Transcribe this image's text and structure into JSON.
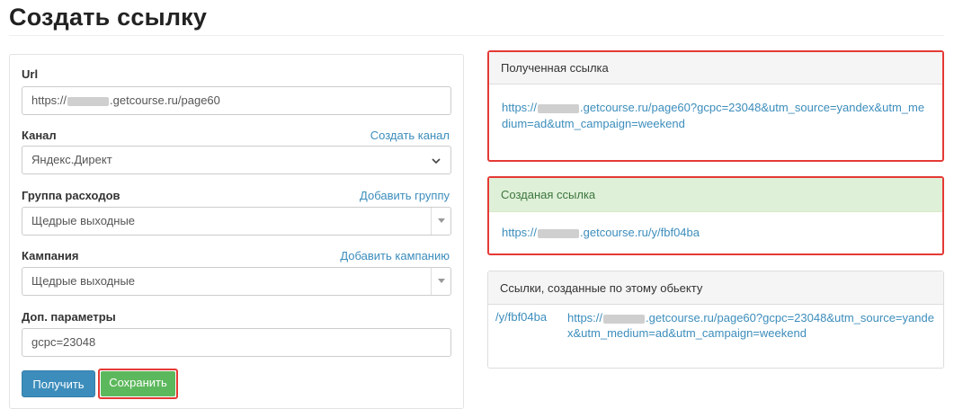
{
  "page": {
    "title": "Создать ссылку"
  },
  "form": {
    "url": {
      "label": "Url",
      "value_prefix": "https://",
      "value_suffix": ".getcourse.ru/page60"
    },
    "channel": {
      "label": "Канал",
      "action": "Создать канал",
      "value": "Яндекс.Директ"
    },
    "expense_group": {
      "label": "Группа расходов",
      "action": "Добавить группу",
      "value": "Щедрые выходные"
    },
    "campaign": {
      "label": "Кампания",
      "action": "Добавить кампанию",
      "value": "Щедрые выходные"
    },
    "extra_params": {
      "label": "Доп. параметры",
      "value": "gcpc=23048"
    },
    "buttons": {
      "get": "Получить",
      "save": "Сохранить"
    }
  },
  "received_link": {
    "header": "Полученная ссылка",
    "prefix": "https://",
    "suffix": ".getcourse.ru/page60?gcpc=23048&utm_source=yandex&utm_medium=ad&utm_campaign=weekend"
  },
  "created_link": {
    "header": "Созданая ссылка",
    "prefix": "https://",
    "suffix": ".getcourse.ru/y/fbf04ba"
  },
  "history": {
    "header": "Ссылки, созданные по этому обьекту",
    "rows": [
      {
        "short": "/y/fbf04ba",
        "prefix": "https://",
        "suffix": ".getcourse.ru/page60?gcpc=23048&utm_source=yandex&utm_medium=ad&utm_campaign=weekend"
      }
    ]
  }
}
